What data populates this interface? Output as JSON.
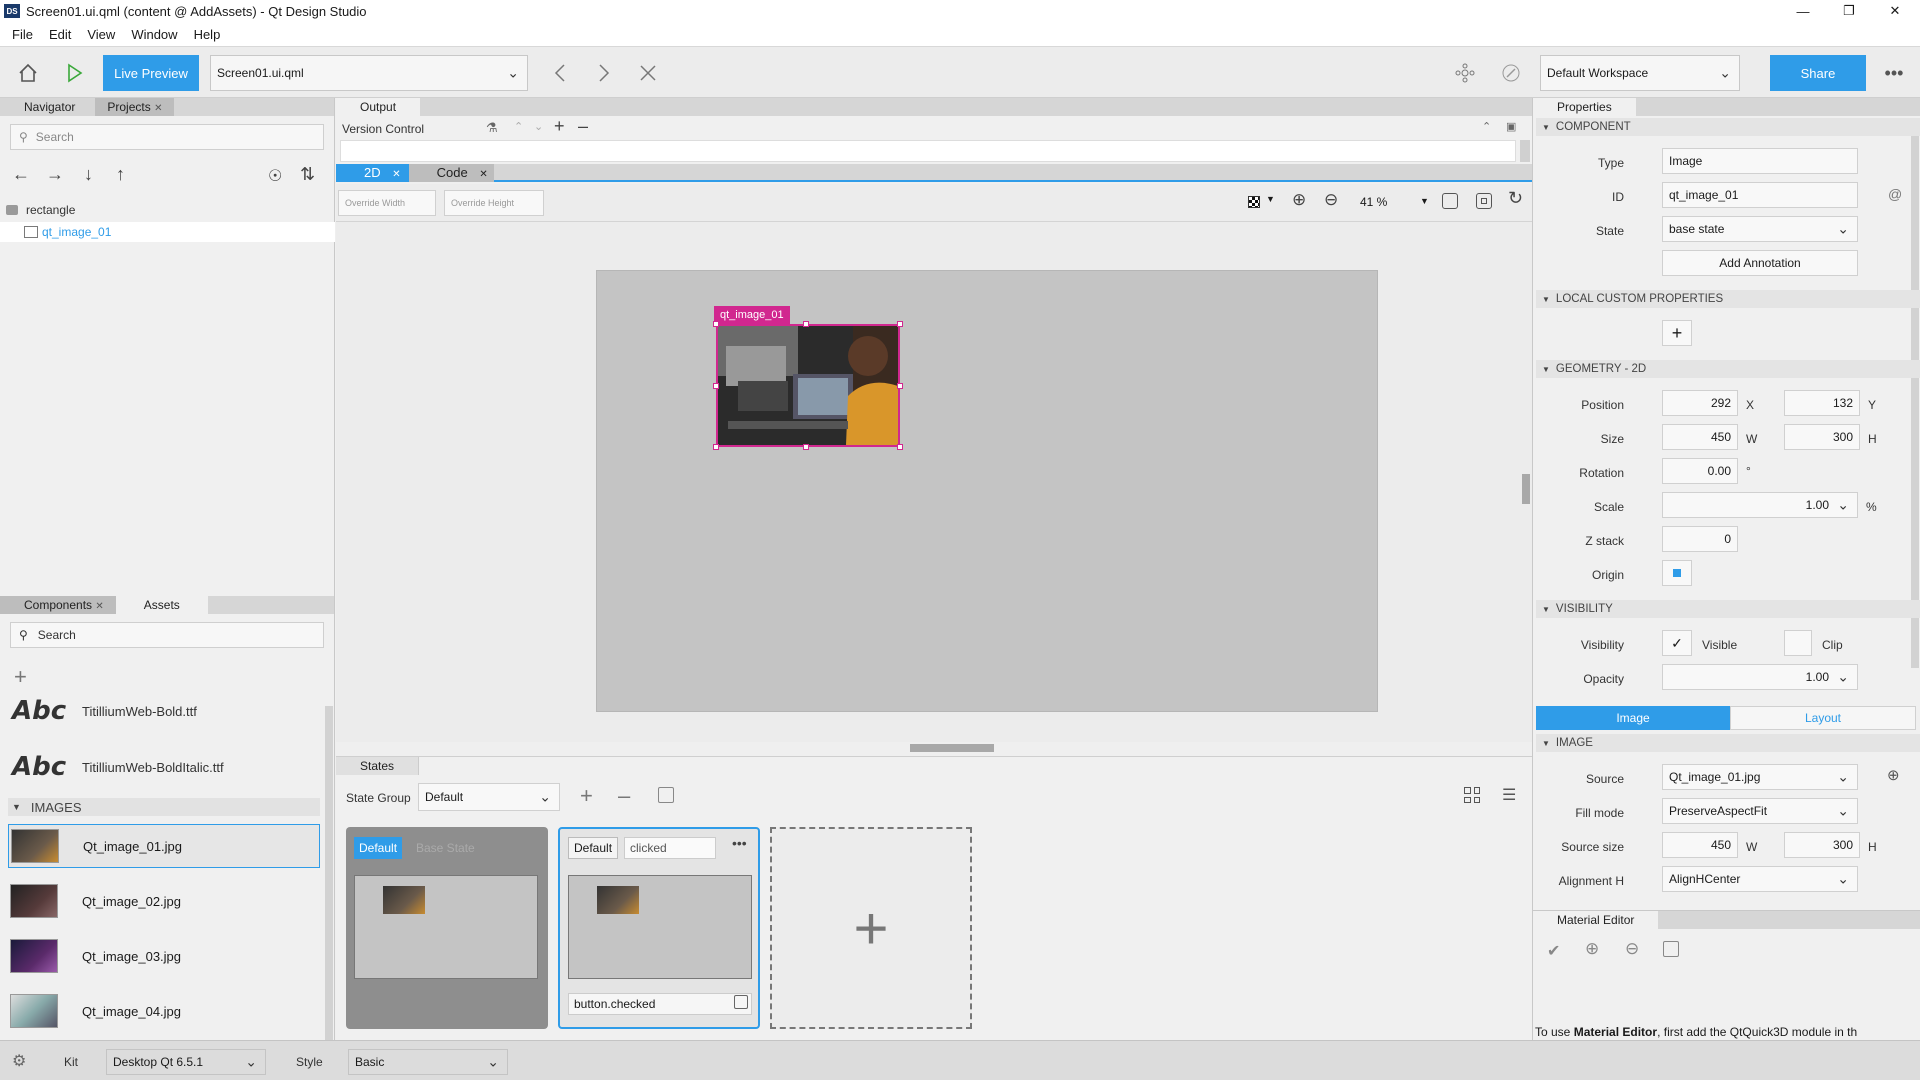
{
  "window": {
    "title": "Screen01.ui.qml (content @ AddAssets) - Qt Design Studio",
    "app_badge": "DS"
  },
  "menu": [
    "File",
    "Edit",
    "View",
    "Window",
    "Help"
  ],
  "toolbar": {
    "live_preview": "Live Preview",
    "file": "Screen01.ui.qml",
    "workspace": "Default Workspace",
    "share": "Share"
  },
  "navigator": {
    "tabs": [
      "Navigator",
      "Projects"
    ],
    "search_placeholder": "Search",
    "tree": [
      {
        "label": "rectangle"
      },
      {
        "label": "qt_image_01"
      }
    ]
  },
  "output": {
    "tab": "Output",
    "version_control": "Version Control"
  },
  "editor": {
    "tabs": [
      "2D",
      "Code"
    ],
    "override_width": "Override Width",
    "override_height": "Override Height",
    "zoom": "41 %",
    "selection_label": "qt_image_01"
  },
  "assets": {
    "tabs": [
      "Components",
      "Assets"
    ],
    "search_placeholder": "Search",
    "fonts": [
      {
        "glyph": "Abc",
        "name": "TitilliumWeb-Bold.ttf"
      },
      {
        "glyph": "Abc",
        "name": "TitilliumWeb-BoldItalic.ttf"
      }
    ],
    "images_header": "IMAGES",
    "images": [
      "Qt_image_01.jpg",
      "Qt_image_02.jpg",
      "Qt_image_03.jpg",
      "Qt_image_04.jpg"
    ]
  },
  "states": {
    "tab": "States",
    "group_label": "State Group",
    "group_value": "Default",
    "base": {
      "badge": "Default",
      "name": "Base State"
    },
    "clicked": {
      "badge": "Default",
      "name": "clicked",
      "condition": "button.checked"
    }
  },
  "properties": {
    "tab": "Properties",
    "component": {
      "header": "COMPONENT",
      "type_label": "Type",
      "type": "Image",
      "id_label": "ID",
      "id": "qt_image_01",
      "state_label": "State",
      "state": "base state",
      "add_annotation": "Add Annotation"
    },
    "local_custom": {
      "header": "LOCAL CUSTOM PROPERTIES"
    },
    "geometry": {
      "header": "GEOMETRY - 2D",
      "position_label": "Position",
      "x": "292",
      "x_unit": "X",
      "y": "132",
      "y_unit": "Y",
      "size_label": "Size",
      "w": "450",
      "w_unit": "W",
      "h": "300",
      "h_unit": "H",
      "rotation_label": "Rotation",
      "rotation": "0.00",
      "rotation_unit": "°",
      "scale_label": "Scale",
      "scale": "1.00",
      "scale_unit": "%",
      "z_label": "Z stack",
      "z": "0",
      "origin_label": "Origin"
    },
    "visibility": {
      "header": "VISIBILITY",
      "visibility_label": "Visibility",
      "visible": "Visible",
      "clip": "Clip",
      "opacity_label": "Opacity",
      "opacity": "1.00"
    },
    "subtabs": [
      "Image",
      "Layout"
    ],
    "image": {
      "header": "IMAGE",
      "source_label": "Source",
      "source": "Qt_image_01.jpg",
      "fill_label": "Fill mode",
      "fill": "PreserveAspectFit",
      "source_size_label": "Source size",
      "sw": "450",
      "sw_unit": "W",
      "sh": "300",
      "sh_unit": "H",
      "align_label": "Alignment H",
      "align": "AlignHCenter"
    }
  },
  "material_editor": {
    "tab": "Material Editor",
    "note_prefix": "To use ",
    "note_bold": "Material Editor",
    "note_suffix": ", first add the QtQuick3D module in th"
  },
  "statusbar": {
    "kit_label": "Kit",
    "kit": "Desktop Qt 6.5.1",
    "style_label": "Style",
    "style": "Basic"
  },
  "colors": {
    "accent": "#2f9ce8",
    "selection": "#d1278f",
    "canvas": "#c4c4c4"
  }
}
